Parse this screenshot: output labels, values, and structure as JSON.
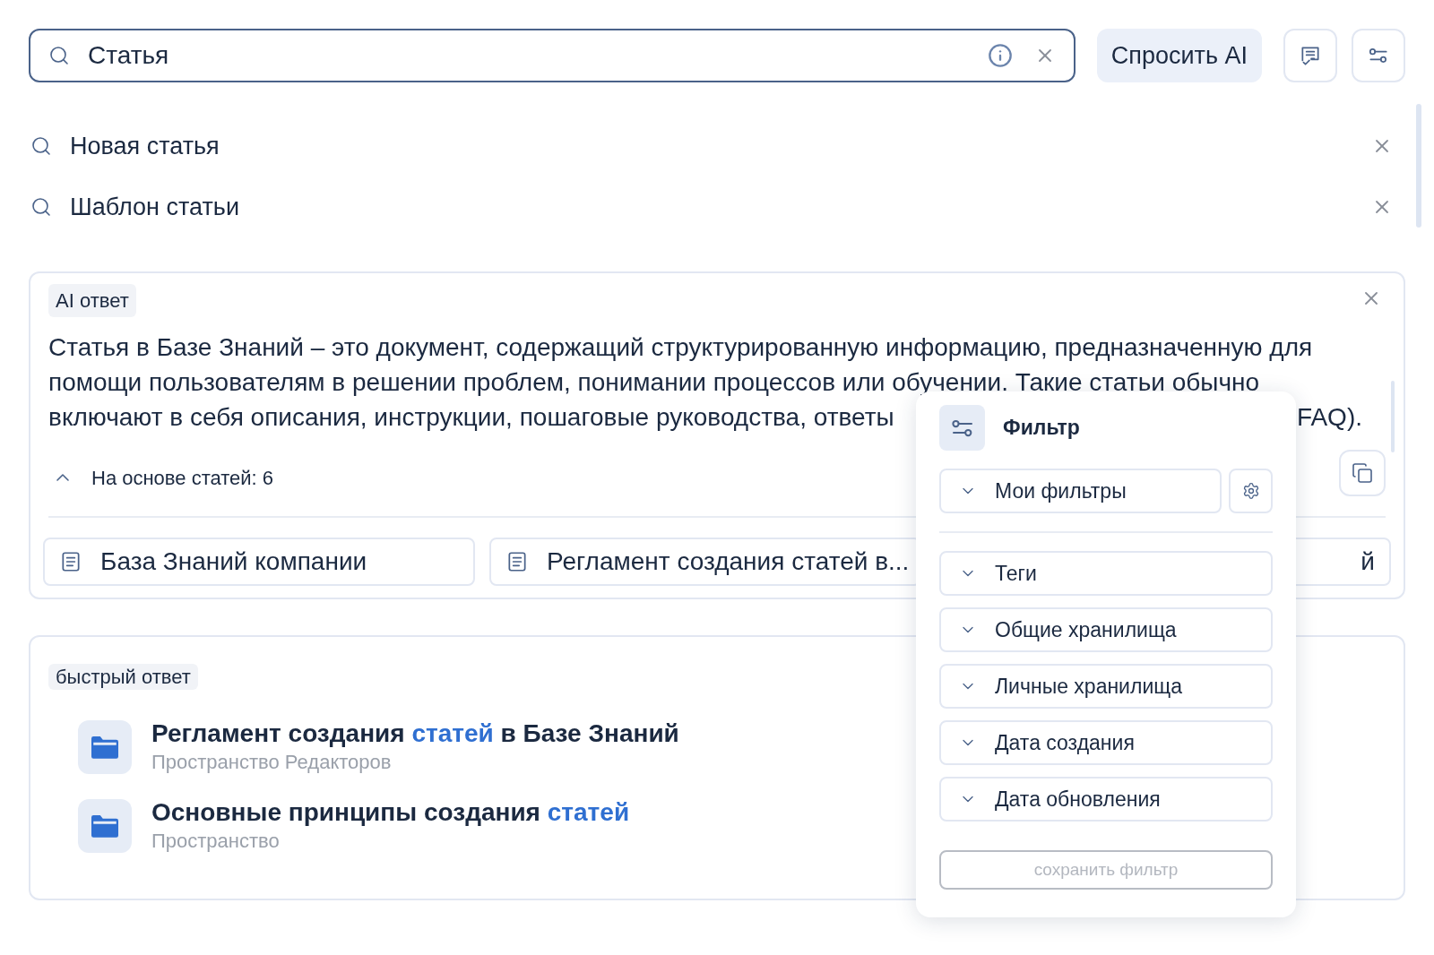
{
  "search": {
    "value": "Статья",
    "ask_button": "Спросить AI"
  },
  "suggestions": [
    {
      "text": "Новая статья"
    },
    {
      "text": "Шаблон статьи"
    }
  ],
  "ai_answer": {
    "badge": "AI ответ",
    "lines": [
      "Статья в Базе Знаний – это документ, содержащий структурированную информацию, предназначенную для",
      "помощи пользователям в решении проблем, понимании процессов или обучении. Такие статьи обычно",
      "включают в себя описания, инструкции, пошаговые руководства, ответы"
    ],
    "tail": "FAQ).",
    "sources_toggle": {
      "label": "На основе статей: 6",
      "expanded": true
    },
    "sources": [
      {
        "title": "База Знаний компании"
      },
      {
        "title": "Регламент создания статей в..."
      },
      {
        "title": "й"
      }
    ]
  },
  "quick_answer": {
    "badge": "быстрый ответ",
    "results": [
      {
        "title_parts": [
          {
            "text": "Регламент создания ",
            "highlight": false
          },
          {
            "text": "статей",
            "highlight": true
          },
          {
            "text": " в Базе Знаний",
            "highlight": false
          }
        ],
        "space": "Пространство Редакторов"
      },
      {
        "title_parts": [
          {
            "text": "Основные принципы создания ",
            "highlight": false
          },
          {
            "text": "статей",
            "highlight": true
          }
        ],
        "space": "Пространство"
      }
    ]
  },
  "filter": {
    "title": "Фильтр",
    "my_filters": "Мои фильтры",
    "items": [
      "Теги",
      "Общие хранилища",
      "Личные хранилища",
      "Дата создания",
      "Дата обновления"
    ],
    "save_button": {
      "label": "сохранить фильтр",
      "disabled": true
    }
  }
}
